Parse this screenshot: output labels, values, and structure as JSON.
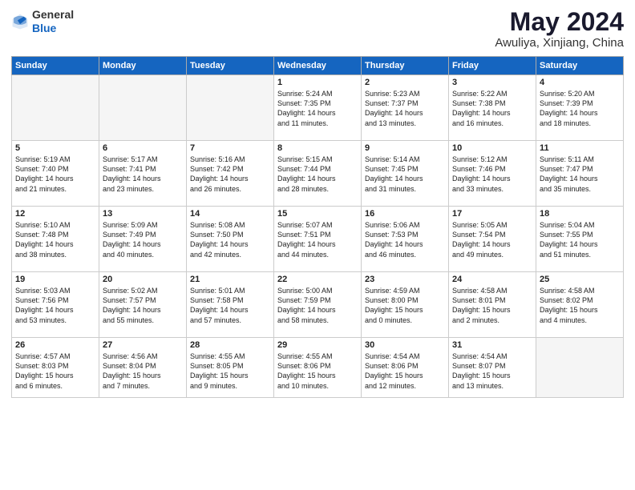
{
  "header": {
    "logo_general": "General",
    "logo_blue": "Blue",
    "month_title": "May 2024",
    "location": "Awuliya, Xinjiang, China"
  },
  "weekdays": [
    "Sunday",
    "Monday",
    "Tuesday",
    "Wednesday",
    "Thursday",
    "Friday",
    "Saturday"
  ],
  "weeks": [
    [
      {
        "day": "",
        "empty": true
      },
      {
        "day": "",
        "empty": true
      },
      {
        "day": "",
        "empty": true
      },
      {
        "day": "1",
        "lines": [
          "Sunrise: 5:24 AM",
          "Sunset: 7:35 PM",
          "Daylight: 14 hours",
          "and 11 minutes."
        ]
      },
      {
        "day": "2",
        "lines": [
          "Sunrise: 5:23 AM",
          "Sunset: 7:37 PM",
          "Daylight: 14 hours",
          "and 13 minutes."
        ]
      },
      {
        "day": "3",
        "lines": [
          "Sunrise: 5:22 AM",
          "Sunset: 7:38 PM",
          "Daylight: 14 hours",
          "and 16 minutes."
        ]
      },
      {
        "day": "4",
        "lines": [
          "Sunrise: 5:20 AM",
          "Sunset: 7:39 PM",
          "Daylight: 14 hours",
          "and 18 minutes."
        ]
      }
    ],
    [
      {
        "day": "5",
        "lines": [
          "Sunrise: 5:19 AM",
          "Sunset: 7:40 PM",
          "Daylight: 14 hours",
          "and 21 minutes."
        ]
      },
      {
        "day": "6",
        "lines": [
          "Sunrise: 5:17 AM",
          "Sunset: 7:41 PM",
          "Daylight: 14 hours",
          "and 23 minutes."
        ]
      },
      {
        "day": "7",
        "lines": [
          "Sunrise: 5:16 AM",
          "Sunset: 7:42 PM",
          "Daylight: 14 hours",
          "and 26 minutes."
        ]
      },
      {
        "day": "8",
        "lines": [
          "Sunrise: 5:15 AM",
          "Sunset: 7:44 PM",
          "Daylight: 14 hours",
          "and 28 minutes."
        ]
      },
      {
        "day": "9",
        "lines": [
          "Sunrise: 5:14 AM",
          "Sunset: 7:45 PM",
          "Daylight: 14 hours",
          "and 31 minutes."
        ]
      },
      {
        "day": "10",
        "lines": [
          "Sunrise: 5:12 AM",
          "Sunset: 7:46 PM",
          "Daylight: 14 hours",
          "and 33 minutes."
        ]
      },
      {
        "day": "11",
        "lines": [
          "Sunrise: 5:11 AM",
          "Sunset: 7:47 PM",
          "Daylight: 14 hours",
          "and 35 minutes."
        ]
      }
    ],
    [
      {
        "day": "12",
        "lines": [
          "Sunrise: 5:10 AM",
          "Sunset: 7:48 PM",
          "Daylight: 14 hours",
          "and 38 minutes."
        ]
      },
      {
        "day": "13",
        "lines": [
          "Sunrise: 5:09 AM",
          "Sunset: 7:49 PM",
          "Daylight: 14 hours",
          "and 40 minutes."
        ]
      },
      {
        "day": "14",
        "lines": [
          "Sunrise: 5:08 AM",
          "Sunset: 7:50 PM",
          "Daylight: 14 hours",
          "and 42 minutes."
        ]
      },
      {
        "day": "15",
        "lines": [
          "Sunrise: 5:07 AM",
          "Sunset: 7:51 PM",
          "Daylight: 14 hours",
          "and 44 minutes."
        ]
      },
      {
        "day": "16",
        "lines": [
          "Sunrise: 5:06 AM",
          "Sunset: 7:53 PM",
          "Daylight: 14 hours",
          "and 46 minutes."
        ]
      },
      {
        "day": "17",
        "lines": [
          "Sunrise: 5:05 AM",
          "Sunset: 7:54 PM",
          "Daylight: 14 hours",
          "and 49 minutes."
        ]
      },
      {
        "day": "18",
        "lines": [
          "Sunrise: 5:04 AM",
          "Sunset: 7:55 PM",
          "Daylight: 14 hours",
          "and 51 minutes."
        ]
      }
    ],
    [
      {
        "day": "19",
        "lines": [
          "Sunrise: 5:03 AM",
          "Sunset: 7:56 PM",
          "Daylight: 14 hours",
          "and 53 minutes."
        ]
      },
      {
        "day": "20",
        "lines": [
          "Sunrise: 5:02 AM",
          "Sunset: 7:57 PM",
          "Daylight: 14 hours",
          "and 55 minutes."
        ]
      },
      {
        "day": "21",
        "lines": [
          "Sunrise: 5:01 AM",
          "Sunset: 7:58 PM",
          "Daylight: 14 hours",
          "and 57 minutes."
        ]
      },
      {
        "day": "22",
        "lines": [
          "Sunrise: 5:00 AM",
          "Sunset: 7:59 PM",
          "Daylight: 14 hours",
          "and 58 minutes."
        ]
      },
      {
        "day": "23",
        "lines": [
          "Sunrise: 4:59 AM",
          "Sunset: 8:00 PM",
          "Daylight: 15 hours",
          "and 0 minutes."
        ]
      },
      {
        "day": "24",
        "lines": [
          "Sunrise: 4:58 AM",
          "Sunset: 8:01 PM",
          "Daylight: 15 hours",
          "and 2 minutes."
        ]
      },
      {
        "day": "25",
        "lines": [
          "Sunrise: 4:58 AM",
          "Sunset: 8:02 PM",
          "Daylight: 15 hours",
          "and 4 minutes."
        ]
      }
    ],
    [
      {
        "day": "26",
        "lines": [
          "Sunrise: 4:57 AM",
          "Sunset: 8:03 PM",
          "Daylight: 15 hours",
          "and 6 minutes."
        ]
      },
      {
        "day": "27",
        "lines": [
          "Sunrise: 4:56 AM",
          "Sunset: 8:04 PM",
          "Daylight: 15 hours",
          "and 7 minutes."
        ]
      },
      {
        "day": "28",
        "lines": [
          "Sunrise: 4:55 AM",
          "Sunset: 8:05 PM",
          "Daylight: 15 hours",
          "and 9 minutes."
        ]
      },
      {
        "day": "29",
        "lines": [
          "Sunrise: 4:55 AM",
          "Sunset: 8:06 PM",
          "Daylight: 15 hours",
          "and 10 minutes."
        ]
      },
      {
        "day": "30",
        "lines": [
          "Sunrise: 4:54 AM",
          "Sunset: 8:06 PM",
          "Daylight: 15 hours",
          "and 12 minutes."
        ]
      },
      {
        "day": "31",
        "lines": [
          "Sunrise: 4:54 AM",
          "Sunset: 8:07 PM",
          "Daylight: 15 hours",
          "and 13 minutes."
        ]
      },
      {
        "day": "",
        "empty": true
      }
    ]
  ]
}
